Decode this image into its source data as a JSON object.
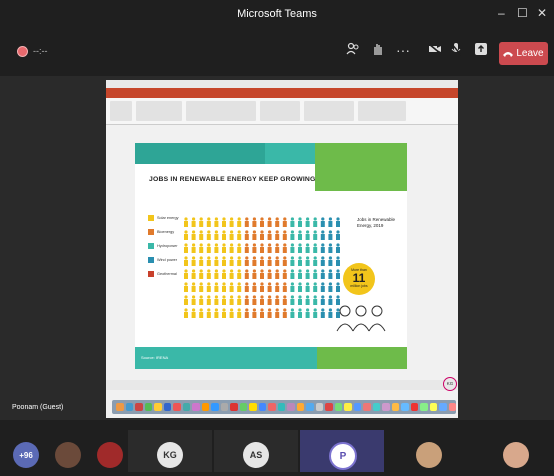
{
  "window": {
    "title": "Microsoft Teams",
    "minimize_label": "–",
    "maximize_label": "☐",
    "close_label": "✕"
  },
  "toolbar": {
    "leave_label": "Leave",
    "more_label": "···"
  },
  "slide": {
    "title": "JOBS IN RENEWABLE ENERGY KEEP GROWING",
    "legend": [
      {
        "label": "Solar energy",
        "color": "#f2c51b"
      },
      {
        "label": "Bioenergy",
        "color": "#e07a2c"
      },
      {
        "label": "Hydropower",
        "color": "#3ab8a8"
      },
      {
        "label": "Wind power",
        "color": "#2a8fb0"
      },
      {
        "label": "Geothermal",
        "color": "#c8402b"
      }
    ],
    "note": "Jobs in Renewable Energy, 2019",
    "circle_top": "More than",
    "circle_value": "11",
    "circle_bottom": "million jobs",
    "source": "Source: IRENA"
  },
  "participant": {
    "guest_label": "Poonam (Guest)"
  },
  "gallery": [
    {
      "label": "+96",
      "color": "#5b6ab5",
      "type": "count"
    },
    {
      "label": "KG",
      "color": "#e6e6e6",
      "type": "initials"
    },
    {
      "label": "AS",
      "color": "#e6e6e6",
      "type": "initials"
    },
    {
      "label": "P",
      "color": "#ffffff",
      "type": "initials"
    }
  ]
}
